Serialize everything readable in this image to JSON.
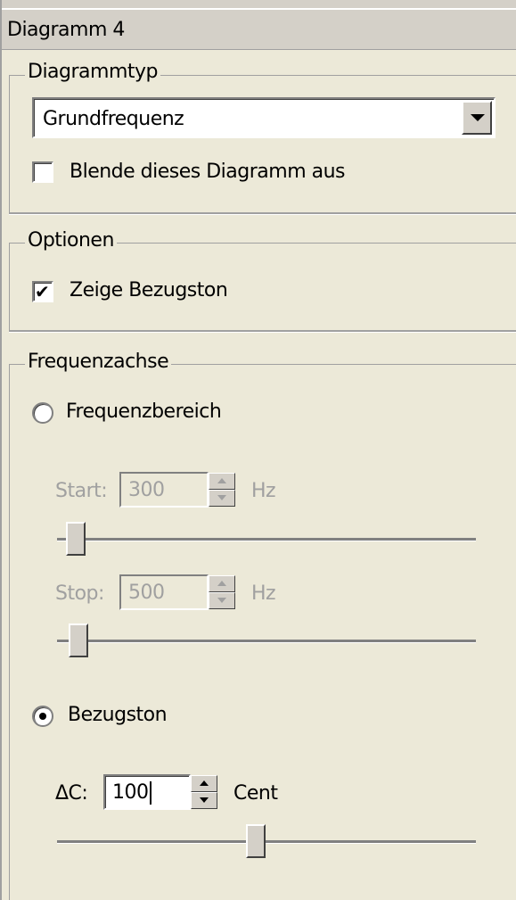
{
  "header": {
    "title": "Diagramm 4"
  },
  "diagrammtyp": {
    "legend": "Diagrammtyp",
    "select_value": "Grundfrequenz",
    "hide_checkbox_label": "Blende dieses Diagramm aus",
    "hide_checked": false
  },
  "optionen": {
    "legend": "Optionen",
    "show_ref_label": "Zeige Bezugston",
    "show_ref_checked": true
  },
  "frequenzachse": {
    "legend": "Frequenzachse",
    "range_radio_label": "Frequenzbereich",
    "range_selected": false,
    "start_label": "Start:",
    "start_value": "300",
    "start_unit": "Hz",
    "stop_label": "Stop:",
    "stop_value": "500",
    "stop_unit": "Hz",
    "ref_radio_label": "Bezugston",
    "ref_selected": true,
    "delta_label": "ΔC:",
    "delta_value": "100",
    "delta_unit": "Cent"
  }
}
